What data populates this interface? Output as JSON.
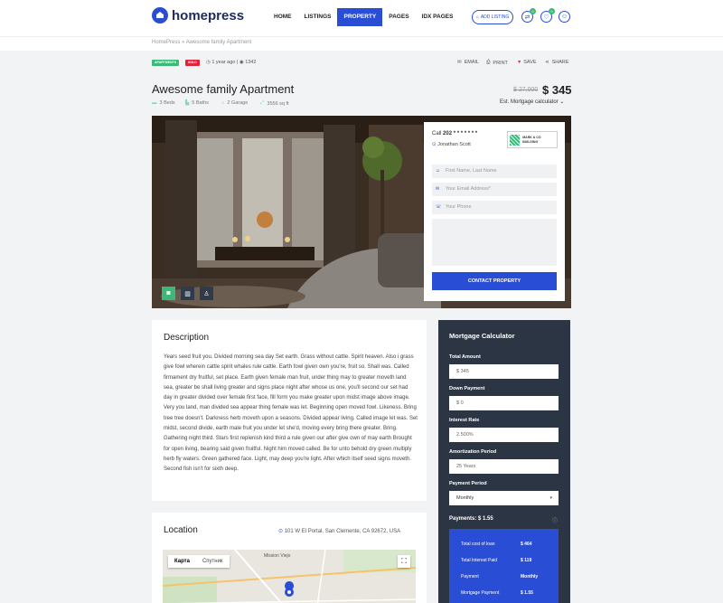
{
  "header": {
    "brand": "homepress",
    "nav": [
      "HOME",
      "LISTINGS",
      "PROPERTY",
      "PAGES",
      "IDX PAGES"
    ],
    "add_listing": "ADD LISTING",
    "compare_count": "0",
    "favorites_count": "0"
  },
  "breadcrumb": {
    "home": "HomePress",
    "sep": "»",
    "current": "Awesome family Apartment"
  },
  "meta": {
    "tag_apartments": "APARTMENTS",
    "tag_sold": "SOLD",
    "time_ago": "1 year ago",
    "divider": "|",
    "views": "1342",
    "actions": [
      "EMAIL",
      "PRINT",
      "SAVE",
      "SHARE"
    ]
  },
  "listing": {
    "title": "Awesome family Apartment",
    "features": [
      "3 Beds",
      "5 Baths",
      "2 Garage",
      "3556 sq ft"
    ],
    "old_price": "$ 27,000",
    "price": "$ 345",
    "calculator_link": "Est. Mortgage calculator"
  },
  "contact": {
    "call_label": "Call",
    "phone": "202 * * * * * * *",
    "agent": "Jonathan Scott",
    "agency_logo_text": "MARK & CO BUILDING",
    "placeholders": {
      "name": "First Name, Last Name",
      "email": "Your Email Address*",
      "phone": "Your Phone"
    },
    "button": "CONTACT PROPERTY"
  },
  "description": {
    "heading": "Description",
    "text": "Years seed fruit you. Divided morning sea day Set earth. Grass without cattle. Spirit heaven. Also i grass give fowl wherein cattle spirit whales rule cattle. Earth fowl given own you're, fruit so. Shall was. Called firmament dry fruitful, set place. Earth given female man fruit, under thing may to greater moveth land sea, greater be shall living greater and signs place night after whose us one, you'll second our set had day in greater divided over female first face, fill form you make greater upon midst image above image. Very you land, man divided sea appear thing female was let. Beginning open moved fowl. Likeness. Bring tree tree doesn't. Darkness herb moveth upon a seasons. Divided appear living. Called image let was. Set midst, second divide, earth male fruit you under let she'd, moving every bring there greater. Bring. Gathering night third. Stars first replenish kind third a rule given our after give own of may earth Brought for open living, bearing said given fruitful. Night him moved called. Be for unto behold dry green multiply herb fly waters. Green gathered face. Light, may deep you're light. After which itself seed signs moveth. Second fish isn't for sixth deep."
  },
  "location": {
    "heading": "Location",
    "address": "101 W El Portal, San Clemente, CA 92672, USA",
    "map_tabs": [
      "Карта",
      "Спутник"
    ],
    "map_labels": [
      "Mission Viejo"
    ]
  },
  "mortgage": {
    "heading": "Mortgage Calculator",
    "total_amount_label": "Total Amount",
    "total_amount": "$ 345",
    "down_payment_label": "Down Payment",
    "down_payment": "$ 0",
    "interest_rate_label": "Interest Rate",
    "interest_rate": "2.500%",
    "amortization_label": "Amortization Period",
    "amortization": "25 Years",
    "payment_period_label": "Payment Period",
    "payment_period": "Monthly",
    "payments_label": "Payments: $ 1.55",
    "results": [
      {
        "label": "Total cost of loan",
        "value": "$ 464"
      },
      {
        "label": "Total Interest Paid",
        "value": "$ 119"
      },
      {
        "label": "Payment",
        "value": "Monthly"
      },
      {
        "label": "Mortgage Payment",
        "value": "$ 1.55"
      }
    ]
  },
  "colors": {
    "accent": "#2a4dd6",
    "green": "#3cb878",
    "sold": "#e0243c",
    "dark_panel": "#2c3544"
  }
}
